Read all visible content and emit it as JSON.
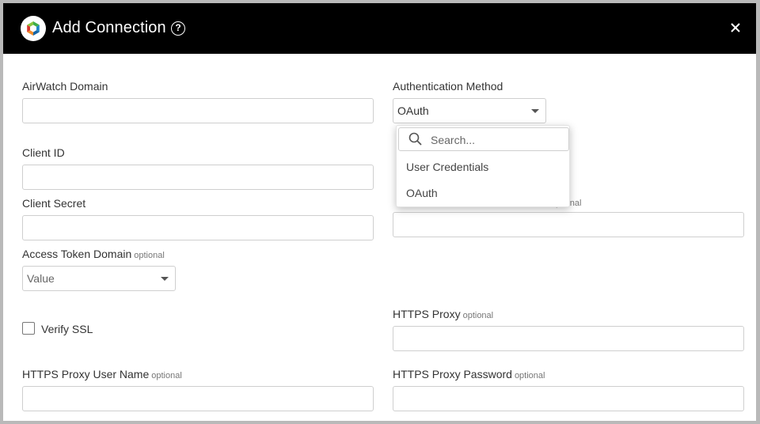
{
  "dialog": {
    "title": "Add Connection",
    "help_symbol": "?",
    "close_symbol": "×"
  },
  "optional_tag": "optional",
  "fields": {
    "airwatch_domain": {
      "label": "AirWatch Domain",
      "value": ""
    },
    "authentication_method": {
      "label": "Authentication Method",
      "selected": "OAuth"
    },
    "client_id": {
      "label": "Client ID",
      "value": ""
    },
    "client_secret": {
      "label": "Client Secret",
      "value": ""
    },
    "obscured_field": {
      "label_partial": "ptional",
      "value": ""
    },
    "access_token_domain": {
      "label": "Access Token Domain",
      "selected": "Value"
    },
    "verify_ssl": {
      "label": "Verify SSL",
      "checked": false
    },
    "https_proxy": {
      "label": "HTTPS Proxy",
      "value": ""
    },
    "https_proxy_user": {
      "label": "HTTPS Proxy User Name",
      "value": ""
    },
    "https_proxy_password": {
      "label": "HTTPS Proxy Password",
      "value": ""
    }
  },
  "auth_dropdown": {
    "search_placeholder": "Search...",
    "options": [
      "User Credentials",
      "OAuth"
    ]
  },
  "colors": {
    "header_bg": "#000000",
    "frame_border": "#b9b9b9",
    "input_border": "#cfcfcf",
    "logo_green": "#3fae49",
    "logo_blue": "#1e88c7",
    "logo_orange": "#f28c28",
    "logo_red": "#d9342b"
  }
}
